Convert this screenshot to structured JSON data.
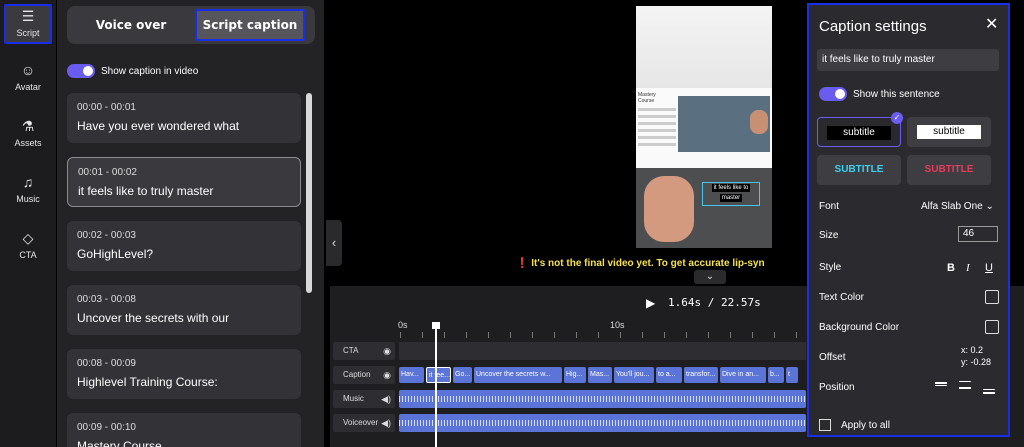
{
  "nav": {
    "items": [
      {
        "label": "Script",
        "icon": "script-icon",
        "glyph": "☰"
      },
      {
        "label": "Avatar",
        "icon": "avatar-icon",
        "glyph": "☺"
      },
      {
        "label": "Assets",
        "icon": "flask-icon",
        "glyph": "⚗"
      },
      {
        "label": "Music",
        "icon": "music-icon",
        "glyph": "♫"
      },
      {
        "label": "CTA",
        "icon": "tag-icon",
        "glyph": "◇"
      }
    ]
  },
  "script_panel": {
    "tab_voice": "Voice over",
    "tab_caption": "Script caption",
    "toggle_label": "Show caption in video",
    "captions": [
      {
        "time": "00:00 - 00:01",
        "text": "Have you ever wondered what"
      },
      {
        "time": "00:01 - 00:02",
        "text": "it feels like to truly master"
      },
      {
        "time": "00:02 - 00:03",
        "text": "GoHighLevel?"
      },
      {
        "time": "00:03 - 00:08",
        "text": "Uncover the secrets with our"
      },
      {
        "time": "00:08 - 00:09",
        "text": "Highlevel Training Course:"
      },
      {
        "time": "00:09 - 00:10",
        "text": "Mastery Course"
      }
    ]
  },
  "preview": {
    "course_label_1": "Mastery",
    "course_label_2": "Course",
    "caption_line_1": "it feels like to",
    "caption_line_2": "master"
  },
  "warning": "❗ It's not the final video yet. To get accurate lip-syn",
  "timeline": {
    "time_current": "1.64s",
    "time_total": "22.57s",
    "time_sep": "/",
    "ruler_0": "0s",
    "ruler_10": "10s",
    "tracks": [
      "CTA",
      "Caption",
      "Music",
      "Voiceover"
    ],
    "caption_clips": [
      "Hav...",
      "it fee...",
      "Go...",
      "Uncover the secrets w...",
      "Hig...",
      "Mas...",
      "You'll jou...",
      "to a...",
      "transfor...",
      "Dive in an...",
      "b...",
      "t"
    ]
  },
  "caption_settings": {
    "title": "Caption settings",
    "sentence": "it feels like to truly master",
    "show_sentence": "Show this sentence",
    "style_1": "subtitle",
    "style_2": "subtitle",
    "style_3": "SUBTITLE",
    "style_4": "SUBTITLE",
    "font_label": "Font",
    "font_value": "Alfa Slab One",
    "size_label": "Size",
    "size_value": "46",
    "style_label": "Style",
    "text_color_label": "Text Color",
    "bg_color_label": "Background Color",
    "offset_label": "Offset",
    "offset_x": "x: 0.2",
    "offset_y": "y: -0.28",
    "position_label": "Position",
    "apply_all": "Apply to all"
  }
}
